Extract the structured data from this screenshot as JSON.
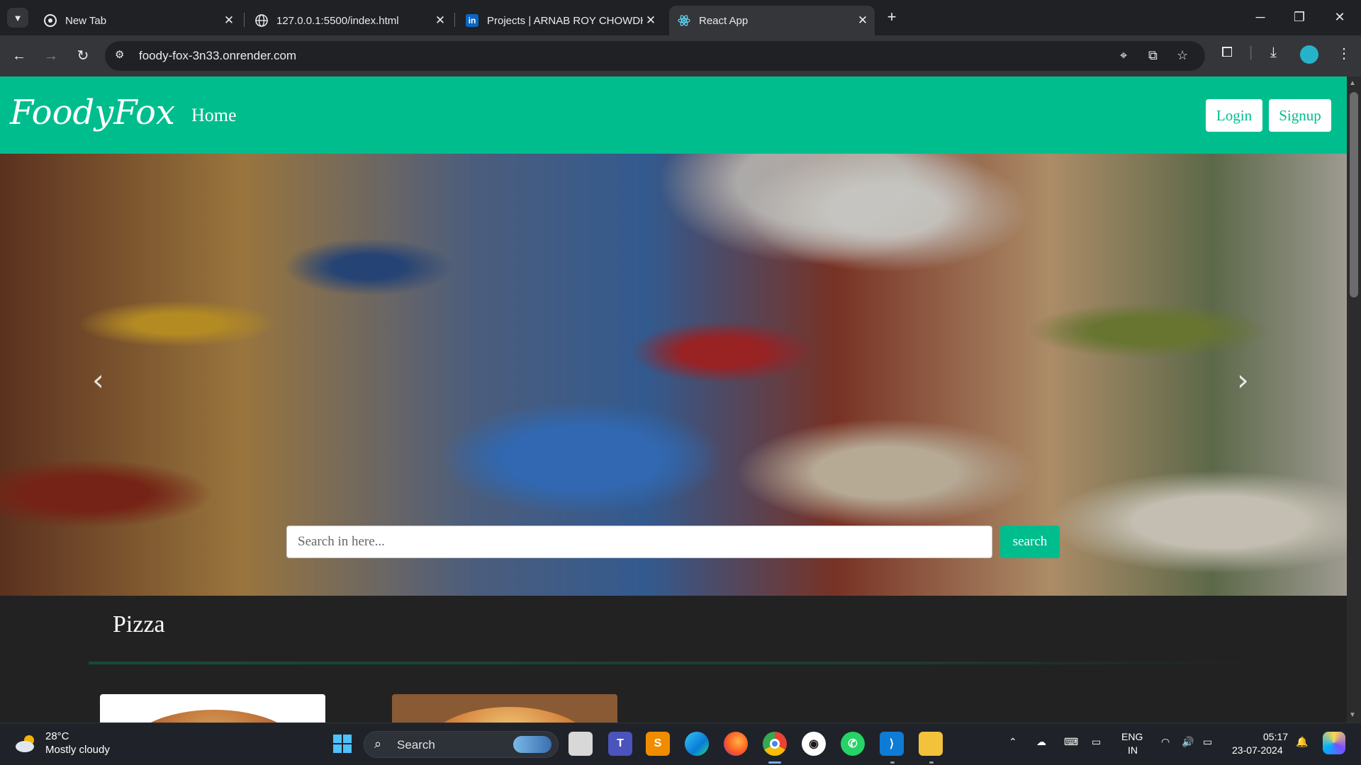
{
  "browser": {
    "tabs": [
      {
        "title": "New Tab",
        "active": false
      },
      {
        "title": "127.0.0.1:5500/index.html",
        "active": false
      },
      {
        "title": "Projects | ARNAB ROY CHOWDHURY",
        "active": false
      },
      {
        "title": "React App",
        "active": true
      }
    ],
    "url": "foody-fox-3n33.onrender.com"
  },
  "site": {
    "brand": "FoodyFox",
    "nav": {
      "home": "Home",
      "login": "Login",
      "signup": "Signup"
    },
    "hero": {
      "search_placeholder": "Search in here...",
      "search_button": "search",
      "prev": "‹",
      "next": "›"
    },
    "category": {
      "title": "Pizza"
    },
    "colors": {
      "brand": "#00bd8e"
    }
  },
  "taskbar": {
    "weather": {
      "temp": "28°C",
      "desc": "Mostly cloudy"
    },
    "search_label": "Search",
    "lang": {
      "line1": "ENG",
      "line2": "IN"
    },
    "time": "05:17",
    "date": "23-07-2024"
  }
}
